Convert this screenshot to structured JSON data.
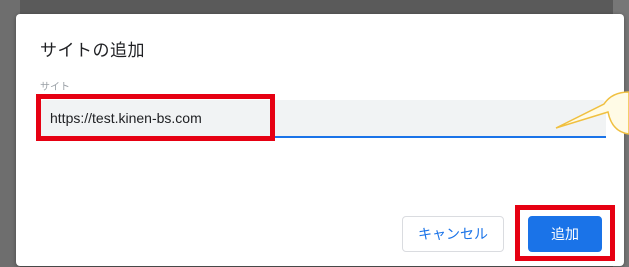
{
  "dialog": {
    "title": "サイトの追加",
    "field_label": "サイト",
    "site_value": "https://test.kinen-bs.com",
    "cancel_label": "キャンセル",
    "add_label": "追加"
  },
  "colors": {
    "accent": "#1a73e8",
    "highlight": "#e60012",
    "callout_fill": "#fffbe6",
    "callout_border": "#f0c040"
  }
}
